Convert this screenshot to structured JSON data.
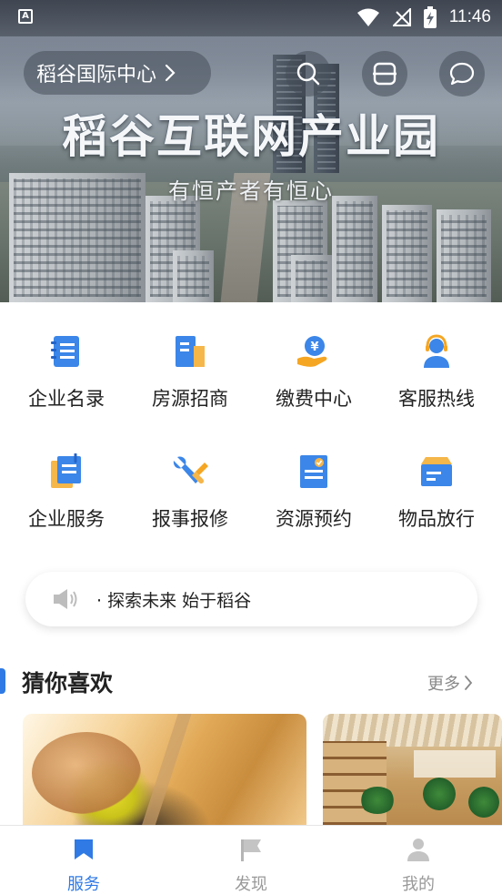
{
  "status_bar": {
    "time": "11:46"
  },
  "header": {
    "location": "稻谷国际中心",
    "banner_title": "稻谷互联网产业园",
    "banner_subtitle": "有恒产者有恒心"
  },
  "quick_actions": [
    {
      "label": "企业名录",
      "icon": "directory-book-icon"
    },
    {
      "label": "房源招商",
      "icon": "building-icon"
    },
    {
      "label": "缴费中心",
      "icon": "payment-hand-icon"
    },
    {
      "label": "客服热线",
      "icon": "customer-service-icon"
    },
    {
      "label": "企业服务",
      "icon": "document-clip-icon"
    },
    {
      "label": "报事报修",
      "icon": "wrench-icon"
    },
    {
      "label": "资源预约",
      "icon": "booking-form-icon"
    },
    {
      "label": "物品放行",
      "icon": "package-box-icon"
    }
  ],
  "notice": {
    "text": "· 探索未来 始于稻谷"
  },
  "recommend": {
    "title": "猜你喜欢",
    "more": "更多"
  },
  "bottom_nav": [
    {
      "label": "服务",
      "active": true
    },
    {
      "label": "发现",
      "active": false
    },
    {
      "label": "我的",
      "active": false
    }
  ],
  "colors": {
    "accent": "#2f7ae5",
    "icon_blue": "#3b86e8",
    "icon_orange": "#f5a623",
    "inactive": "#999999"
  }
}
